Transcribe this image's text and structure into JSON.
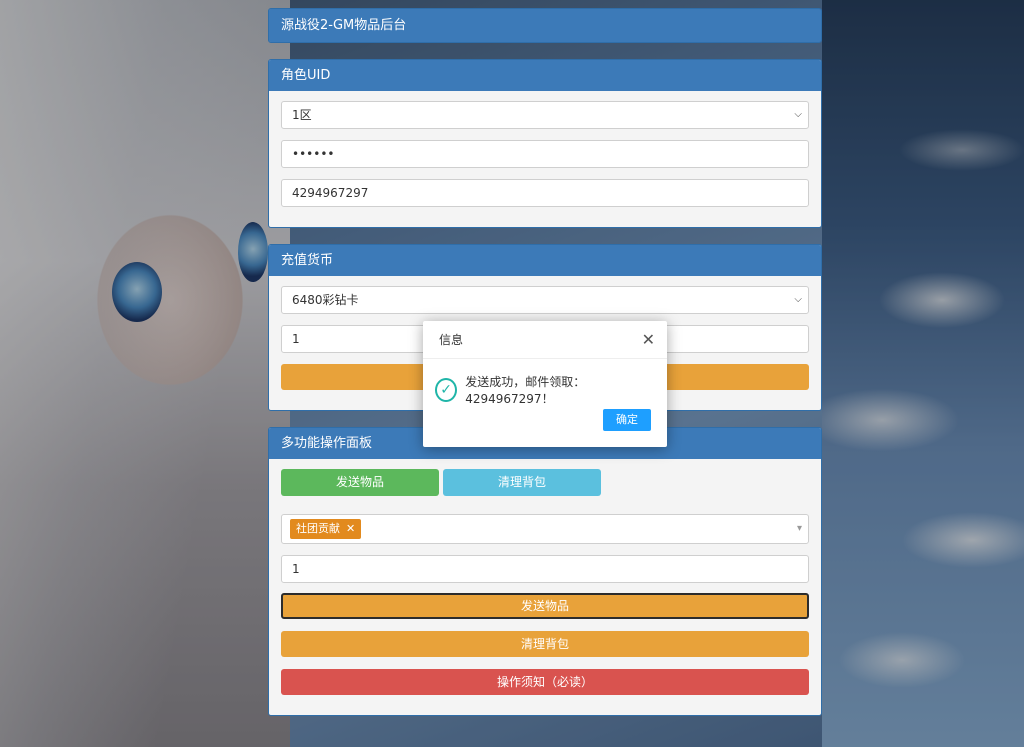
{
  "header": {
    "title": "源战役2-GM物品后台"
  },
  "role_panel": {
    "title": "角色UID",
    "server_value": "1区",
    "password_value": "••••••",
    "uid_value": "4294967297"
  },
  "recharge_panel": {
    "title": "充值货币",
    "currency_value": "6480彩钻卡",
    "amount_value": "1"
  },
  "multi_panel": {
    "title": "多功能操作面板",
    "tab_send": "发送物品",
    "tab_clear": "清理背包",
    "selected_tag": "社团贡献",
    "quantity_value": "1",
    "send_button": "发送物品",
    "clear_button": "清理背包",
    "notice_button": "操作须知（必读）"
  },
  "dialog": {
    "title": "信息",
    "message": "发送成功，邮件领取：4294967297！",
    "ok_label": "确定"
  },
  "colors": {
    "header_blue": "#3c7ab8",
    "orange": "#e8a23a",
    "green": "#5cb85c",
    "teal": "#5bc0de",
    "red": "#d9534f",
    "tag_orange": "#e28a1e",
    "ok_blue": "#1e9fff"
  }
}
